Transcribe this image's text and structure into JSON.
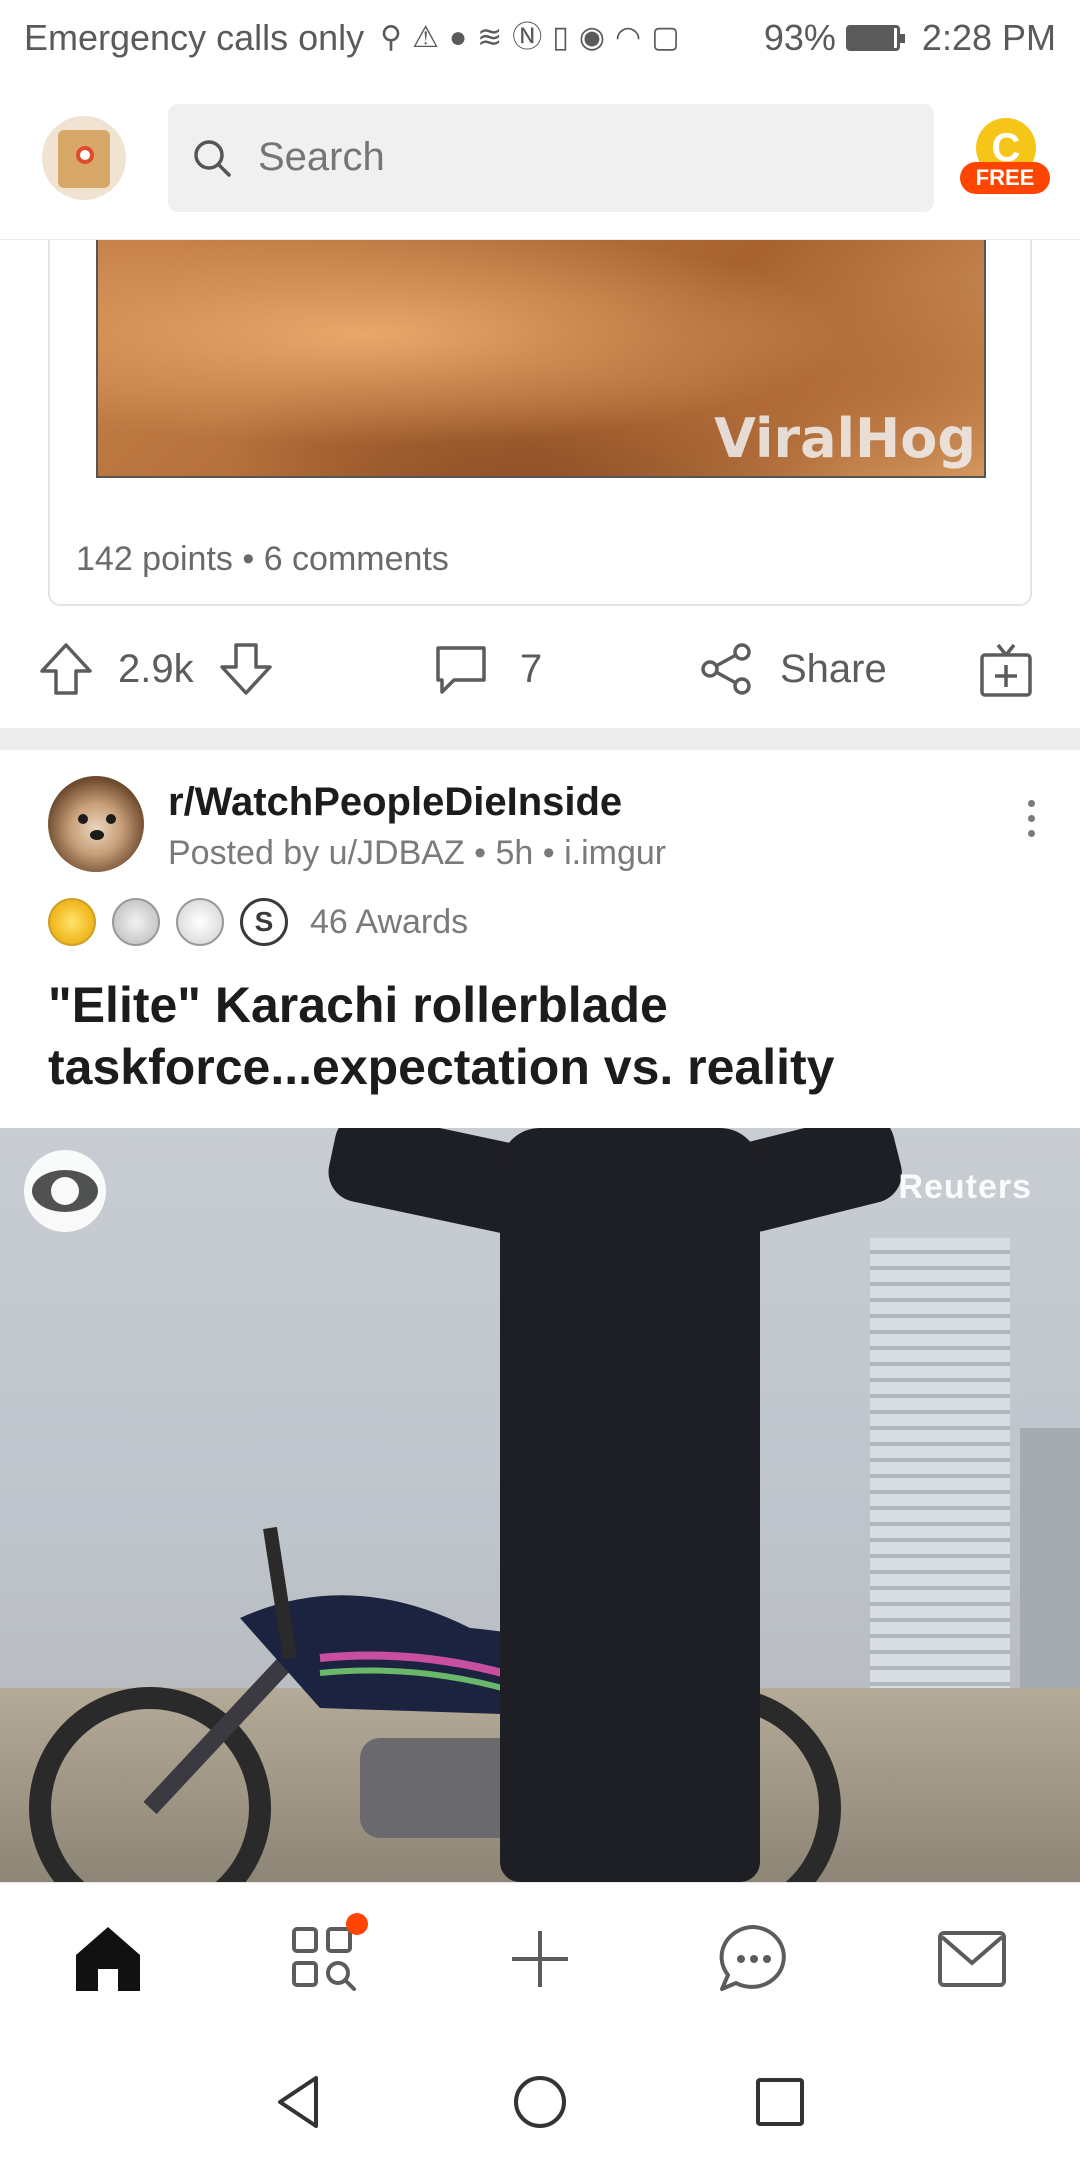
{
  "status_bar": {
    "carrier_text": "Emergency calls only",
    "battery_percent": "93%",
    "battery_level": 0.93,
    "time": "2:28 PM",
    "icons": [
      "usb-icon",
      "warning-icon",
      "apple-icon",
      "swipe-icon",
      "nfc-icon",
      "vibrate-icon",
      "eye-icon",
      "wifi-icon",
      "battery-alert-icon"
    ]
  },
  "header": {
    "search_placeholder": "Search",
    "coin_letter": "C",
    "free_badge": "FREE"
  },
  "previous_post": {
    "watermark": "ViralHog",
    "meta": "142 points • 6 comments",
    "upvotes": "2.9k",
    "comments": "7",
    "share_label": "Share"
  },
  "post": {
    "subreddit": "r/WatchPeopleDieInside",
    "meta": "Posted by u/JDBAZ • 5h • i.imgur",
    "awards_count": "46 Awards",
    "award_letter": "S",
    "title": "\"Elite\" Karachi rollerblade taskforce...expectation vs. reality",
    "image_watermark": "Reuters"
  },
  "colors": {
    "accent": "#ff4500",
    "coin": "#f5c518",
    "text_primary": "#1c1c1c",
    "text_secondary": "#7a7a7a"
  },
  "bottom_nav": {
    "items": [
      "home-icon",
      "discover-icon",
      "create-post-icon",
      "chat-icon",
      "inbox-icon"
    ]
  },
  "system_nav": {
    "items": [
      "back-icon",
      "home-circle-icon",
      "recents-icon"
    ]
  }
}
